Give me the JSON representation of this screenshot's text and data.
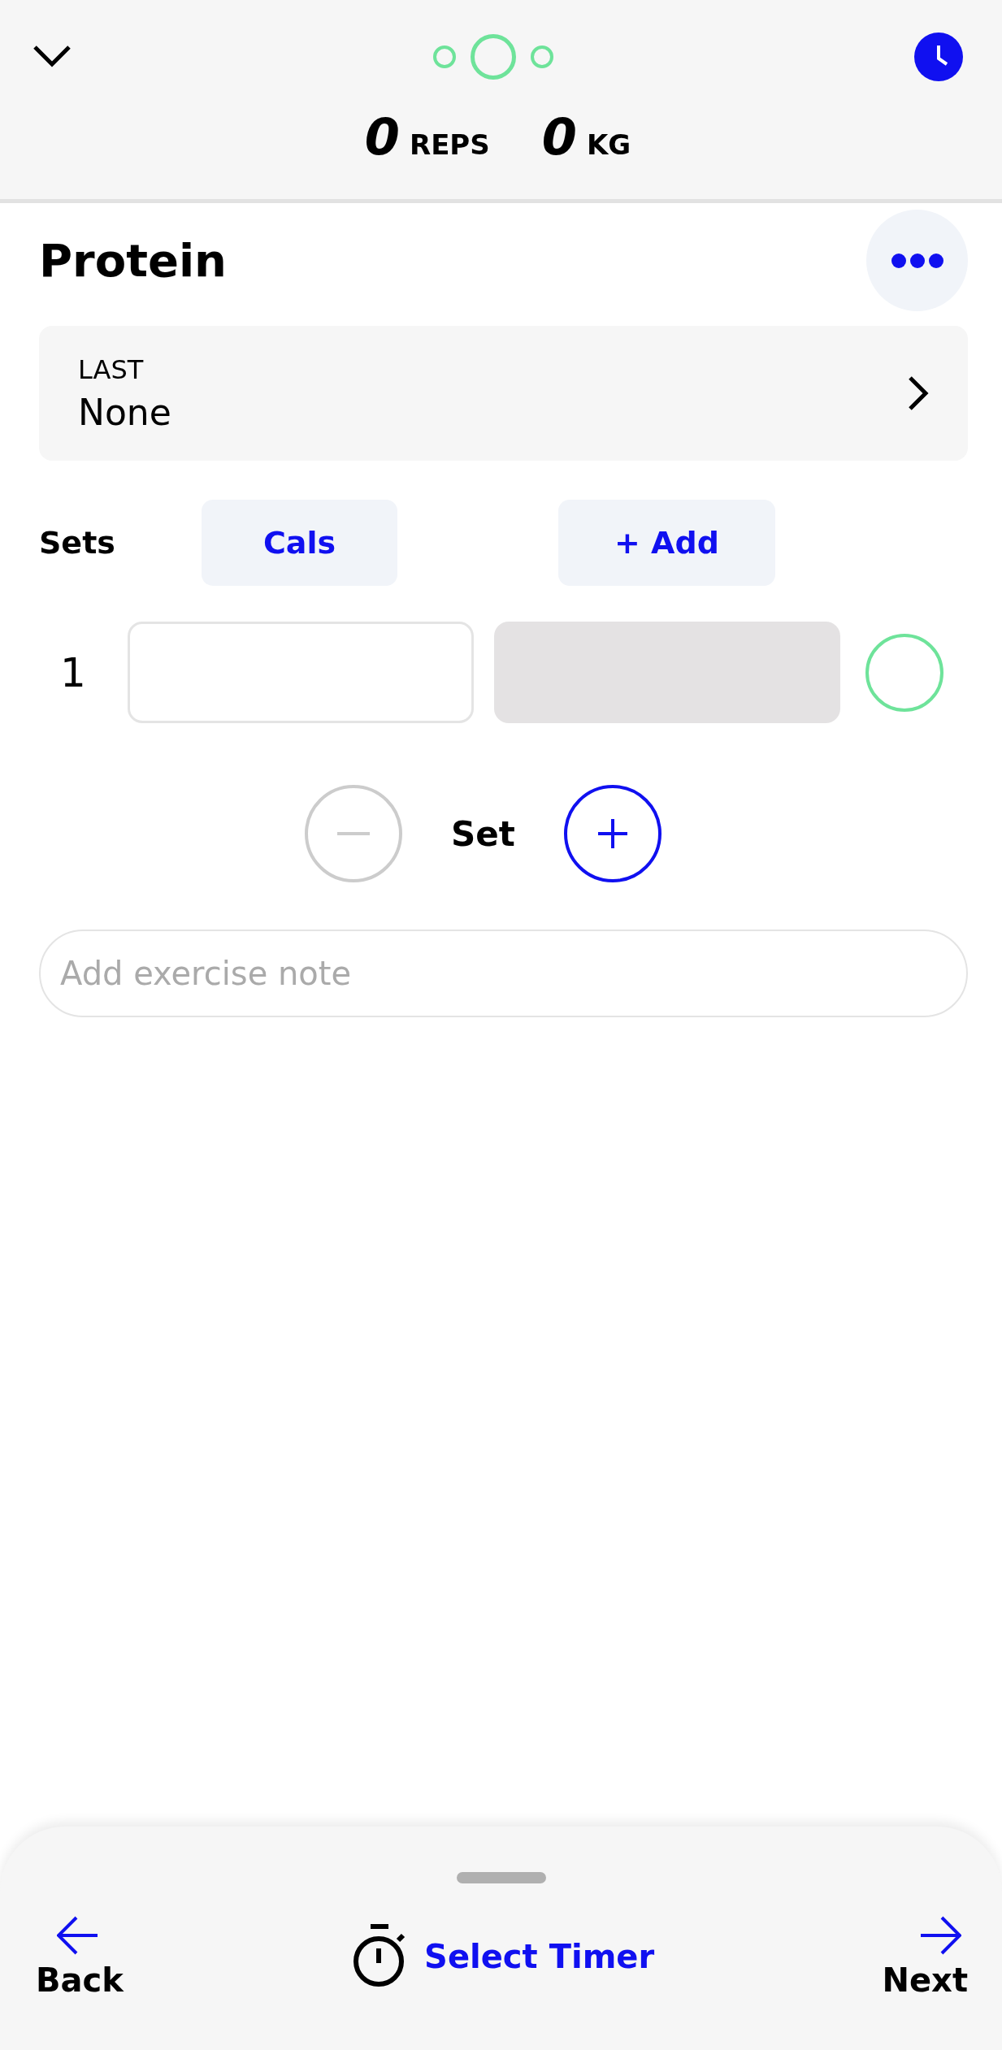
{
  "header": {
    "pages": [
      {
        "selected": false
      },
      {
        "selected": true
      },
      {
        "selected": false
      }
    ],
    "stats": [
      {
        "value": "0",
        "unit": "REPS"
      },
      {
        "value": "0",
        "unit": "KG"
      }
    ]
  },
  "exercise": {
    "title": "Protein"
  },
  "last": {
    "label": "LAST",
    "value": "None"
  },
  "sets_header": {
    "label": "Sets",
    "columns": [
      {
        "label": "Cals"
      },
      {
        "label": "+ Add"
      }
    ]
  },
  "sets": [
    {
      "number": "1",
      "done": false,
      "fields": [
        {
          "disabled": false
        },
        {
          "disabled": true
        }
      ]
    }
  ],
  "stepper": {
    "label": "Set",
    "minus_disabled": true,
    "plus_disabled": false
  },
  "note": {
    "placeholder": "Add exercise note"
  },
  "footer": {
    "back": "Back",
    "timer": "Select Timer",
    "next": "Next"
  }
}
